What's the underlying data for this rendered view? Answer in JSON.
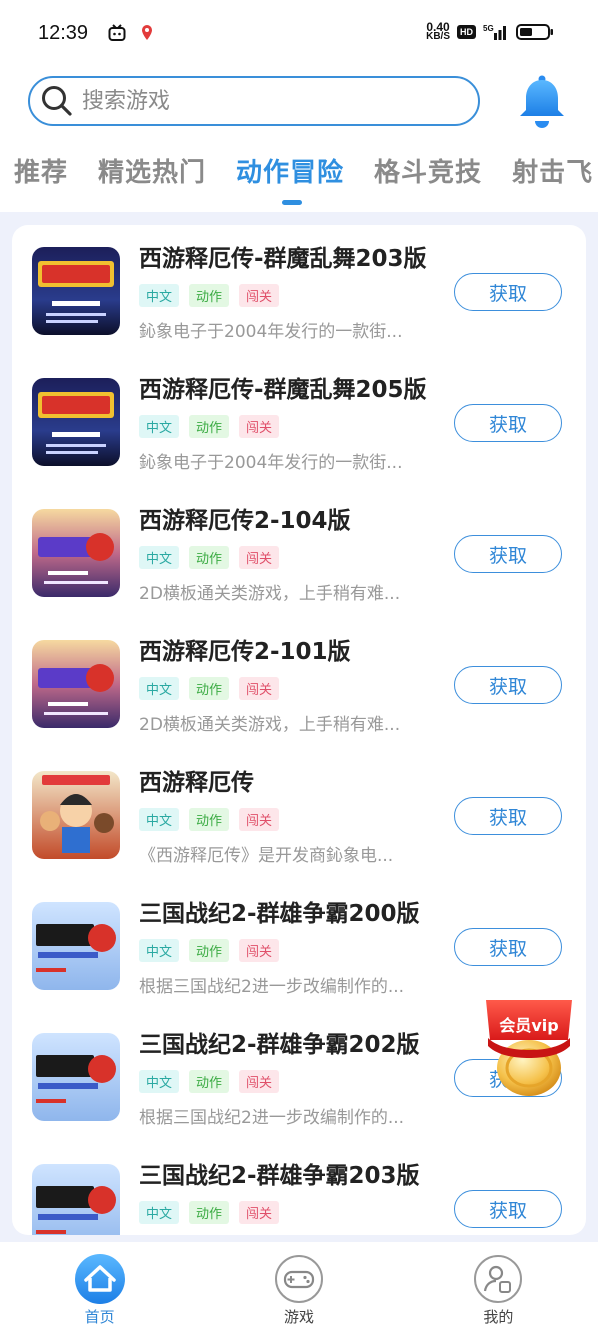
{
  "status": {
    "time": "12:39",
    "speed_value": "0.40",
    "speed_unit": "KB/S",
    "hd": "HD",
    "network": "5G"
  },
  "search": {
    "placeholder": "搜索游戏"
  },
  "tabs": [
    {
      "label": "推荐",
      "active": false
    },
    {
      "label": "精选热门",
      "active": false
    },
    {
      "label": "动作冒险",
      "active": true
    },
    {
      "label": "格斗竞技",
      "active": false
    },
    {
      "label": "射击飞",
      "active": false
    }
  ],
  "games": [
    {
      "title": "西游释厄传-群魔乱舞203版",
      "tags": [
        "中文",
        "动作",
        "闯关"
      ],
      "desc": "鈊象电子于2004年发行的一款街...",
      "button": "获取",
      "thumb": "night-title"
    },
    {
      "title": "西游释厄传-群魔乱舞205版",
      "tags": [
        "中文",
        "动作",
        "闯关"
      ],
      "desc": "鈊象电子于2004年发行的一款街...",
      "button": "获取",
      "thumb": "night-title"
    },
    {
      "title": "西游释厄传2-104版",
      "tags": [
        "中文",
        "动作",
        "闯关"
      ],
      "desc": "2D横板通关类游戏，上手稍有难...",
      "button": "获取",
      "thumb": "dusk-title"
    },
    {
      "title": "西游释厄传2-101版",
      "tags": [
        "中文",
        "动作",
        "闯关"
      ],
      "desc": "2D横板通关类游戏，上手稍有难...",
      "button": "获取",
      "thumb": "dusk-title"
    },
    {
      "title": "西游释厄传",
      "tags": [
        "中文",
        "动作",
        "闯关"
      ],
      "desc": "《西游释厄传》是开发商鈊象电...",
      "button": "获取",
      "thumb": "characters"
    },
    {
      "title": "三国战纪2-群雄争霸200版",
      "tags": [
        "中文",
        "动作",
        "闯关"
      ],
      "desc": "根据三国战纪2进一步改编制作的...",
      "button": "获取",
      "thumb": "sky-title"
    },
    {
      "title": "三国战纪2-群雄争霸202版",
      "tags": [
        "中文",
        "动作",
        "闯关"
      ],
      "desc": "根据三国战纪2进一步改编制作的...",
      "button": "获取",
      "thumb": "sky-title"
    },
    {
      "title": "三国战纪2-群雄争霸203版",
      "tags": [
        "中文",
        "动作",
        "闯关"
      ],
      "desc": "",
      "button": "获取",
      "thumb": "sky-title"
    }
  ],
  "vip": {
    "label": "会员vip"
  },
  "nav": [
    {
      "label": "首页",
      "icon": "home-icon",
      "active": true
    },
    {
      "label": "游戏",
      "icon": "gamepad-icon",
      "active": false
    },
    {
      "label": "我的",
      "icon": "user-icon",
      "active": false
    }
  ],
  "colors": {
    "accent": "#2f8fe0",
    "background": "#eef1fb"
  }
}
